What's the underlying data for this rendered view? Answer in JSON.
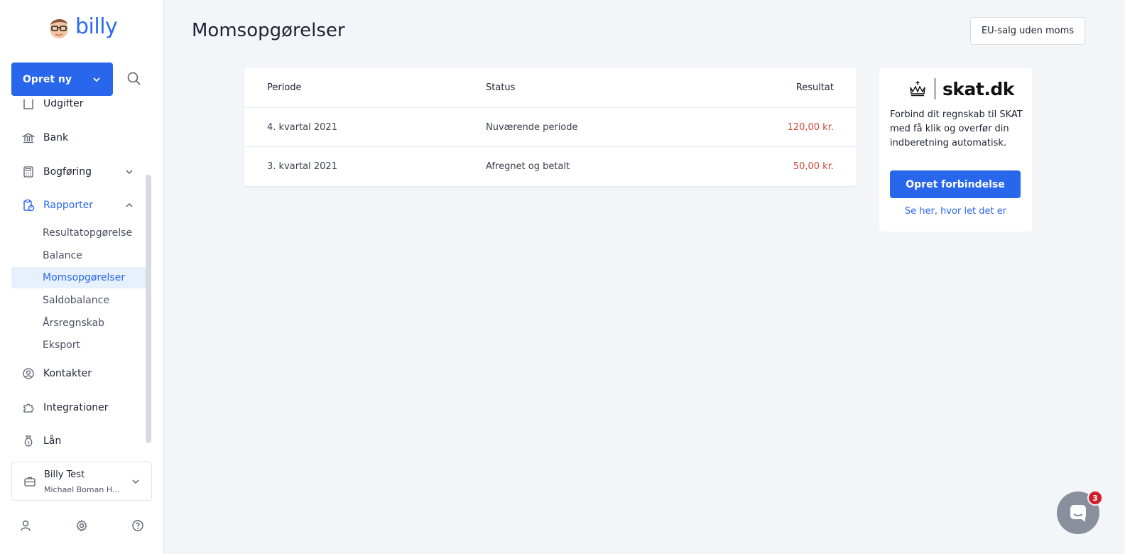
{
  "app": {
    "logo_text": "billy"
  },
  "sidebar": {
    "create_label": "Opret ny",
    "partial_item": "Udgifter",
    "items": [
      {
        "label": "Bank",
        "icon": "bank-icon"
      },
      {
        "label": "Bogføring",
        "icon": "calculator-icon"
      },
      {
        "label": "Rapporter",
        "icon": "report-icon"
      },
      {
        "label": "Kontakter",
        "icon": "contact-icon"
      },
      {
        "label": "Integrationer",
        "icon": "puzzle-icon"
      },
      {
        "label": "Lån",
        "icon": "money-bag-icon"
      }
    ],
    "sub_items": [
      {
        "label": "Resultatopgørelse"
      },
      {
        "label": "Balance"
      },
      {
        "label": "Momsopgørelser"
      },
      {
        "label": "Saldobalance"
      },
      {
        "label": "Årsregnskab"
      },
      {
        "label": "Eksport"
      }
    ],
    "org": {
      "name": "Billy Test",
      "user": "Michael Boman H..."
    }
  },
  "main": {
    "title": "Momsopgørelser",
    "eu_button": "EU-salg uden moms",
    "table": {
      "columns": [
        "Periode",
        "Status",
        "Resultat"
      ],
      "rows": [
        {
          "period": "4. kvartal 2021",
          "status": "Nuværende periode",
          "result": "120,00 kr."
        },
        {
          "period": "3. kvartal 2021",
          "status": "Afregnet og betalt",
          "result": "50,00 kr."
        }
      ]
    }
  },
  "skat": {
    "logo_text": "skat.dk",
    "description": "Forbind dit regnskab til SKAT med få klik og overfør din indberetning automatisk.",
    "button": "Opret forbindelse",
    "link": "Se her, hvor let det er"
  },
  "chat": {
    "badge_count": "3"
  },
  "colors": {
    "accent": "#2867ec",
    "negative": "#d0473a",
    "badge": "#d21d29"
  }
}
